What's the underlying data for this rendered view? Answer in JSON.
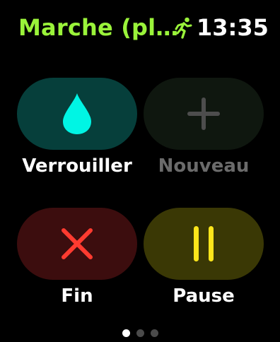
{
  "status_bar": {
    "title": "Marche (pl…",
    "time": "13:35",
    "icon": "running-figure-icon",
    "title_color": "#9af33a"
  },
  "controls": [
    {
      "id": "lock",
      "label": "Verrouiller",
      "icon": "water-drop-icon",
      "button_color": "#063f3b",
      "icon_color": "#00f5e4",
      "enabled": true
    },
    {
      "id": "new",
      "label": "Nouveau",
      "icon": "plus-icon",
      "button_color": "#0f170f",
      "icon_color": "#4d4d4d",
      "enabled": false
    },
    {
      "id": "end",
      "label": "Fin",
      "icon": "x-mark-icon",
      "button_color": "#3c0d0e",
      "icon_color": "#ff3b30",
      "enabled": true
    },
    {
      "id": "pause",
      "label": "Pause",
      "icon": "pause-icon",
      "button_color": "#3a3805",
      "icon_color": "#fde51b",
      "enabled": true
    }
  ],
  "page_indicator": {
    "pages": 3,
    "current": 1
  }
}
